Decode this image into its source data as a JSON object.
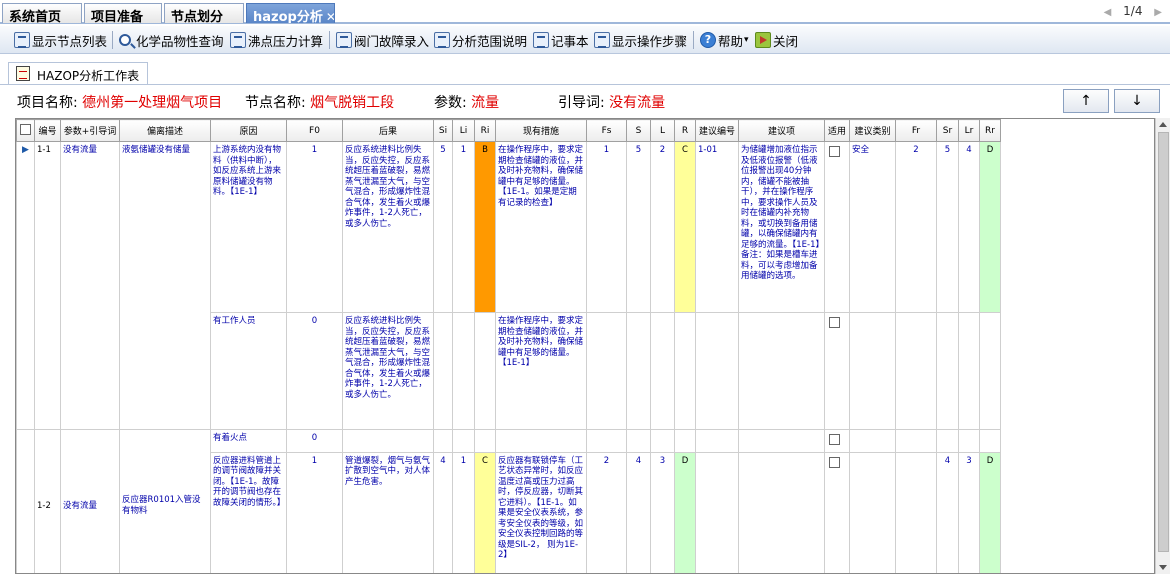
{
  "tabs": [
    {
      "label": "系统首页"
    },
    {
      "label": "项目准备"
    },
    {
      "label": "节点划分"
    },
    {
      "label": "hazop分析"
    }
  ],
  "pager": {
    "text": "1/4"
  },
  "toolbar": [
    {
      "label": "显示节点列表",
      "icon": "list-icon"
    },
    {
      "label": "化学品物性查询",
      "icon": "search-icon"
    },
    {
      "label": "沸点压力计算",
      "icon": "document-icon"
    },
    {
      "label": "阀门故障录入",
      "icon": "valve-icon"
    },
    {
      "label": "分析范围说明",
      "icon": "valve-icon"
    },
    {
      "label": "记事本",
      "icon": "notepad-icon"
    },
    {
      "label": "显示操作步骤",
      "icon": "steps-icon"
    },
    {
      "label": "帮助",
      "icon": "help-icon"
    },
    {
      "label": "关闭",
      "icon": "exit-icon"
    }
  ],
  "workspace_tab": {
    "label": "HAZOP分析工作表"
  },
  "info": {
    "project_label": "项目名称:",
    "project_value": "德州第一处理烟气项目",
    "node_label": "节点名称:",
    "node_value": "烟气脱销工段",
    "param_label": "参数:",
    "param_value": "流量",
    "guide_label": "引导词:",
    "guide_value": "没有流量"
  },
  "nav": {
    "up": "↑",
    "down": "↓"
  },
  "columns": [
    "编号",
    "参数+引导词",
    "偏离描述",
    "原因",
    "F0",
    "后果",
    "Si",
    "Li",
    "Ri",
    "现有措施",
    "Fs",
    "S",
    "L",
    "R",
    "建议编号",
    "建议项",
    "适用",
    "建议类别",
    "Fr",
    "Sr",
    "Lr",
    "Rr"
  ],
  "rows": [
    {
      "id": "1-1",
      "param": "没有流量",
      "deviation": "液氨储罐没有储量",
      "causes": [
        {
          "text": "上游系统内没有物料（供料中断），如反应系统上游来原料储罐没有物料。【1E-1】",
          "f0": "1"
        },
        {
          "text": "有工作人员",
          "f0": "0"
        }
      ],
      "consequences": [
        "反应系统进料比例失当，反应失控，反应系统超压着蓝破裂，易燃蒸气泄漏至大气，与空气混合，形成爆炸性混合气体，发生着火或爆炸事件，1-2人死亡，或多人伤亡。",
        "反应系统进料比例失当，反应失控，反应系统超压着蓝破裂，易燃蒸气泄漏至大气，与空气混合，形成爆炸性混合气体，发生着火或爆炸事件，1-2人死亡，或多人伤亡。"
      ],
      "si": "5",
      "li": "1",
      "ri": "B",
      "measures": [
        "在操作程序中，要求定期检查储罐的液位，并及时补充物料，确保储罐中有足够的储量。【1E-1。如果是定期有记录的检查】",
        "在操作程序中，要求定期检查储罐的液位，并及时补充物料，确保储罐中有足够的储量。【1E-1】"
      ],
      "fs": "1",
      "s": "5",
      "l": "2",
      "r": "C",
      "sugg_id": "1-01",
      "suggestion": "为储罐增加液位指示及低液位报警（低液位报警出现40分钟内，储罐不能被抽干），并在操作程序中，要求操作人员及时在储罐内补充物料，或切换到备用储罐，以确保储罐内有足够的流量。【1E-1】备注：如果是槽车进料，可以考虑增加备用储罐的选项。",
      "category": "安全",
      "fr": "2",
      "sr": "5",
      "lr": "4",
      "rr": "D"
    },
    {
      "id": "1-2",
      "param": "没有流量",
      "deviation": "反应器R0101入管没有物料",
      "causes": [
        {
          "text": "有着火点",
          "f0": "0"
        },
        {
          "text": "反应器进料管道上的调节阀故障并关闭。【1E-1。故障开的调节阀也存在故障关闭的情形。】",
          "f0": "1"
        }
      ],
      "consequences": [
        "",
        "管道爆裂，烟气与氨气扩散到空气中，对人体产生危害。"
      ],
      "si": "4",
      "li": "1",
      "ri": "C",
      "measures": [
        "",
        "反应器有联锁停车（工艺状态异常时，如反应温度过高或压力过高时，停反应器，切断其它进料）。【1E-1。如果是安全仪表系统，参考安全仪表的等级，如安全仪表控制回路的等级是SIL-2， 则为1E-2】"
      ],
      "fs": "2",
      "s": "4",
      "l": "3",
      "r": "D",
      "sugg_id": "",
      "suggestion": "",
      "category": "",
      "fr": "",
      "sr": "4",
      "lr": "3",
      "rr": "D"
    }
  ],
  "colors": {
    "orange": "#ff9900",
    "yellow": "#ffff99",
    "green": "#ccffcc",
    "value_red": "#e00000",
    "link_blue": "#0000aa"
  }
}
